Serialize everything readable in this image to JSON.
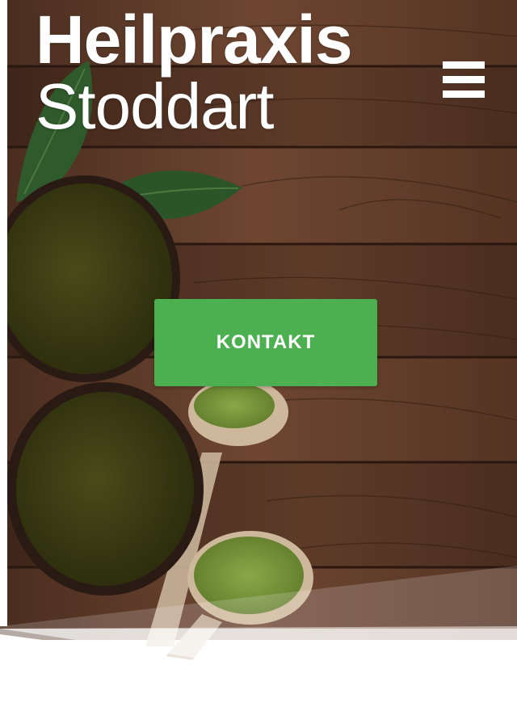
{
  "header": {
    "logo_line1": "Heilpraxis",
    "logo_line2": "Stoddart",
    "menu_icon": "hamburger-menu-icon"
  },
  "hero": {
    "cta_label": "KONTAKT",
    "cta_color": "#4caf50",
    "background": "wooden-table-with-matcha-tea-bowls-and-leaves"
  },
  "colors": {
    "wood_dark": "#3a2418",
    "wood_light": "#6b4430",
    "tea_green": "#3a3d14",
    "leaf_green": "#2e5a2e",
    "matcha_powder": "#7c9a3c"
  }
}
